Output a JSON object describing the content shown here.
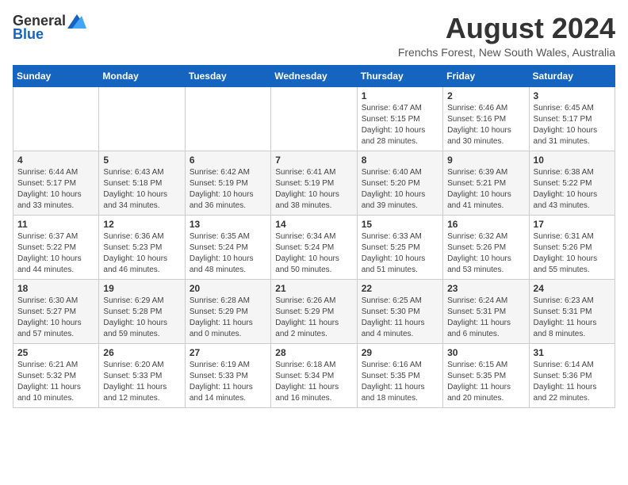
{
  "logo": {
    "general": "General",
    "blue": "Blue"
  },
  "title": {
    "month_year": "August 2024",
    "location": "Frenchs Forest, New South Wales, Australia"
  },
  "weekdays": [
    "Sunday",
    "Monday",
    "Tuesday",
    "Wednesday",
    "Thursday",
    "Friday",
    "Saturday"
  ],
  "weeks": [
    [
      {
        "day": "",
        "sunrise": "",
        "sunset": "",
        "daylight": ""
      },
      {
        "day": "",
        "sunrise": "",
        "sunset": "",
        "daylight": ""
      },
      {
        "day": "",
        "sunrise": "",
        "sunset": "",
        "daylight": ""
      },
      {
        "day": "",
        "sunrise": "",
        "sunset": "",
        "daylight": ""
      },
      {
        "day": "1",
        "sunrise": "Sunrise: 6:47 AM",
        "sunset": "Sunset: 5:15 PM",
        "daylight": "Daylight: 10 hours and 28 minutes."
      },
      {
        "day": "2",
        "sunrise": "Sunrise: 6:46 AM",
        "sunset": "Sunset: 5:16 PM",
        "daylight": "Daylight: 10 hours and 30 minutes."
      },
      {
        "day": "3",
        "sunrise": "Sunrise: 6:45 AM",
        "sunset": "Sunset: 5:17 PM",
        "daylight": "Daylight: 10 hours and 31 minutes."
      }
    ],
    [
      {
        "day": "4",
        "sunrise": "Sunrise: 6:44 AM",
        "sunset": "Sunset: 5:17 PM",
        "daylight": "Daylight: 10 hours and 33 minutes."
      },
      {
        "day": "5",
        "sunrise": "Sunrise: 6:43 AM",
        "sunset": "Sunset: 5:18 PM",
        "daylight": "Daylight: 10 hours and 34 minutes."
      },
      {
        "day": "6",
        "sunrise": "Sunrise: 6:42 AM",
        "sunset": "Sunset: 5:19 PM",
        "daylight": "Daylight: 10 hours and 36 minutes."
      },
      {
        "day": "7",
        "sunrise": "Sunrise: 6:41 AM",
        "sunset": "Sunset: 5:19 PM",
        "daylight": "Daylight: 10 hours and 38 minutes."
      },
      {
        "day": "8",
        "sunrise": "Sunrise: 6:40 AM",
        "sunset": "Sunset: 5:20 PM",
        "daylight": "Daylight: 10 hours and 39 minutes."
      },
      {
        "day": "9",
        "sunrise": "Sunrise: 6:39 AM",
        "sunset": "Sunset: 5:21 PM",
        "daylight": "Daylight: 10 hours and 41 minutes."
      },
      {
        "day": "10",
        "sunrise": "Sunrise: 6:38 AM",
        "sunset": "Sunset: 5:22 PM",
        "daylight": "Daylight: 10 hours and 43 minutes."
      }
    ],
    [
      {
        "day": "11",
        "sunrise": "Sunrise: 6:37 AM",
        "sunset": "Sunset: 5:22 PM",
        "daylight": "Daylight: 10 hours and 44 minutes."
      },
      {
        "day": "12",
        "sunrise": "Sunrise: 6:36 AM",
        "sunset": "Sunset: 5:23 PM",
        "daylight": "Daylight: 10 hours and 46 minutes."
      },
      {
        "day": "13",
        "sunrise": "Sunrise: 6:35 AM",
        "sunset": "Sunset: 5:24 PM",
        "daylight": "Daylight: 10 hours and 48 minutes."
      },
      {
        "day": "14",
        "sunrise": "Sunrise: 6:34 AM",
        "sunset": "Sunset: 5:24 PM",
        "daylight": "Daylight: 10 hours and 50 minutes."
      },
      {
        "day": "15",
        "sunrise": "Sunrise: 6:33 AM",
        "sunset": "Sunset: 5:25 PM",
        "daylight": "Daylight: 10 hours and 51 minutes."
      },
      {
        "day": "16",
        "sunrise": "Sunrise: 6:32 AM",
        "sunset": "Sunset: 5:26 PM",
        "daylight": "Daylight: 10 hours and 53 minutes."
      },
      {
        "day": "17",
        "sunrise": "Sunrise: 6:31 AM",
        "sunset": "Sunset: 5:26 PM",
        "daylight": "Daylight: 10 hours and 55 minutes."
      }
    ],
    [
      {
        "day": "18",
        "sunrise": "Sunrise: 6:30 AM",
        "sunset": "Sunset: 5:27 PM",
        "daylight": "Daylight: 10 hours and 57 minutes."
      },
      {
        "day": "19",
        "sunrise": "Sunrise: 6:29 AM",
        "sunset": "Sunset: 5:28 PM",
        "daylight": "Daylight: 10 hours and 59 minutes."
      },
      {
        "day": "20",
        "sunrise": "Sunrise: 6:28 AM",
        "sunset": "Sunset: 5:29 PM",
        "daylight": "Daylight: 11 hours and 0 minutes."
      },
      {
        "day": "21",
        "sunrise": "Sunrise: 6:26 AM",
        "sunset": "Sunset: 5:29 PM",
        "daylight": "Daylight: 11 hours and 2 minutes."
      },
      {
        "day": "22",
        "sunrise": "Sunrise: 6:25 AM",
        "sunset": "Sunset: 5:30 PM",
        "daylight": "Daylight: 11 hours and 4 minutes."
      },
      {
        "day": "23",
        "sunrise": "Sunrise: 6:24 AM",
        "sunset": "Sunset: 5:31 PM",
        "daylight": "Daylight: 11 hours and 6 minutes."
      },
      {
        "day": "24",
        "sunrise": "Sunrise: 6:23 AM",
        "sunset": "Sunset: 5:31 PM",
        "daylight": "Daylight: 11 hours and 8 minutes."
      }
    ],
    [
      {
        "day": "25",
        "sunrise": "Sunrise: 6:21 AM",
        "sunset": "Sunset: 5:32 PM",
        "daylight": "Daylight: 11 hours and 10 minutes."
      },
      {
        "day": "26",
        "sunrise": "Sunrise: 6:20 AM",
        "sunset": "Sunset: 5:33 PM",
        "daylight": "Daylight: 11 hours and 12 minutes."
      },
      {
        "day": "27",
        "sunrise": "Sunrise: 6:19 AM",
        "sunset": "Sunset: 5:33 PM",
        "daylight": "Daylight: 11 hours and 14 minutes."
      },
      {
        "day": "28",
        "sunrise": "Sunrise: 6:18 AM",
        "sunset": "Sunset: 5:34 PM",
        "daylight": "Daylight: 11 hours and 16 minutes."
      },
      {
        "day": "29",
        "sunrise": "Sunrise: 6:16 AM",
        "sunset": "Sunset: 5:35 PM",
        "daylight": "Daylight: 11 hours and 18 minutes."
      },
      {
        "day": "30",
        "sunrise": "Sunrise: 6:15 AM",
        "sunset": "Sunset: 5:35 PM",
        "daylight": "Daylight: 11 hours and 20 minutes."
      },
      {
        "day": "31",
        "sunrise": "Sunrise: 6:14 AM",
        "sunset": "Sunset: 5:36 PM",
        "daylight": "Daylight: 11 hours and 22 minutes."
      }
    ]
  ]
}
